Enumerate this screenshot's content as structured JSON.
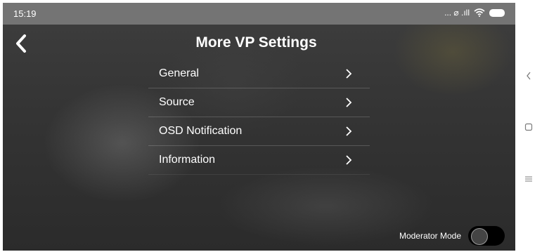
{
  "status_bar": {
    "time": "15:19",
    "indicators": "... ⌀ .ıll"
  },
  "header": {
    "title": "More VP Settings"
  },
  "menu": {
    "items": [
      {
        "label": "General"
      },
      {
        "label": "Source"
      },
      {
        "label": "OSD Notification"
      },
      {
        "label": "Information"
      }
    ]
  },
  "footer": {
    "moderator_label": "Moderator Mode",
    "moderator_enabled": false
  },
  "nav": {
    "icons": [
      "back-icon",
      "home-icon",
      "menu-icon"
    ]
  },
  "colors": {
    "status_bar": "#747474",
    "background": "#343434",
    "toggle_track": "#000000",
    "text": "#ffffff"
  }
}
